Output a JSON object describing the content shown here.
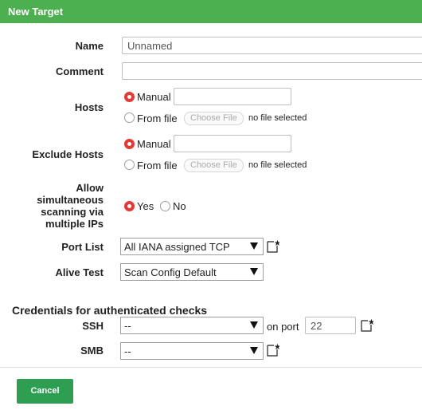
{
  "dialog": {
    "title": "New Target"
  },
  "form": {
    "name": {
      "label": "Name",
      "value": "Unnamed"
    },
    "comment": {
      "label": "Comment",
      "value": ""
    },
    "hosts": {
      "label": "Hosts",
      "manual_label": "Manual",
      "manual_value": "",
      "from_file_label": "From file",
      "file_button": "Choose File",
      "file_status": "no file selected",
      "selected": "Manual"
    },
    "exclude_hosts": {
      "label": "Exclude Hosts",
      "manual_label": "Manual",
      "manual_value": "",
      "from_file_label": "From file",
      "file_button": "Choose File",
      "file_status": "no file selected",
      "selected": "Manual"
    },
    "allow_simultaneous": {
      "label_lines": [
        "Allow",
        "simultaneous",
        "scanning via",
        "multiple IPs"
      ],
      "yes_label": "Yes",
      "no_label": "No",
      "selected": "Yes"
    },
    "port_list": {
      "label": "Port List",
      "value": "All IANA assigned TCP"
    },
    "alive_test": {
      "label": "Alive Test",
      "value": "Scan Config Default"
    },
    "credentials": {
      "heading": "Credentials for authenticated checks",
      "ssh": {
        "label": "SSH",
        "value": "--",
        "port_label": "on port",
        "port_value": "22"
      },
      "smb": {
        "label": "SMB",
        "value": "--"
      }
    }
  },
  "footer": {
    "cancel_label": "Cancel"
  },
  "colors": {
    "header": "#4caf50",
    "button": "#2e9e52",
    "radio_on": "#e53935"
  },
  "icons": {
    "new": "new-item-icon"
  }
}
